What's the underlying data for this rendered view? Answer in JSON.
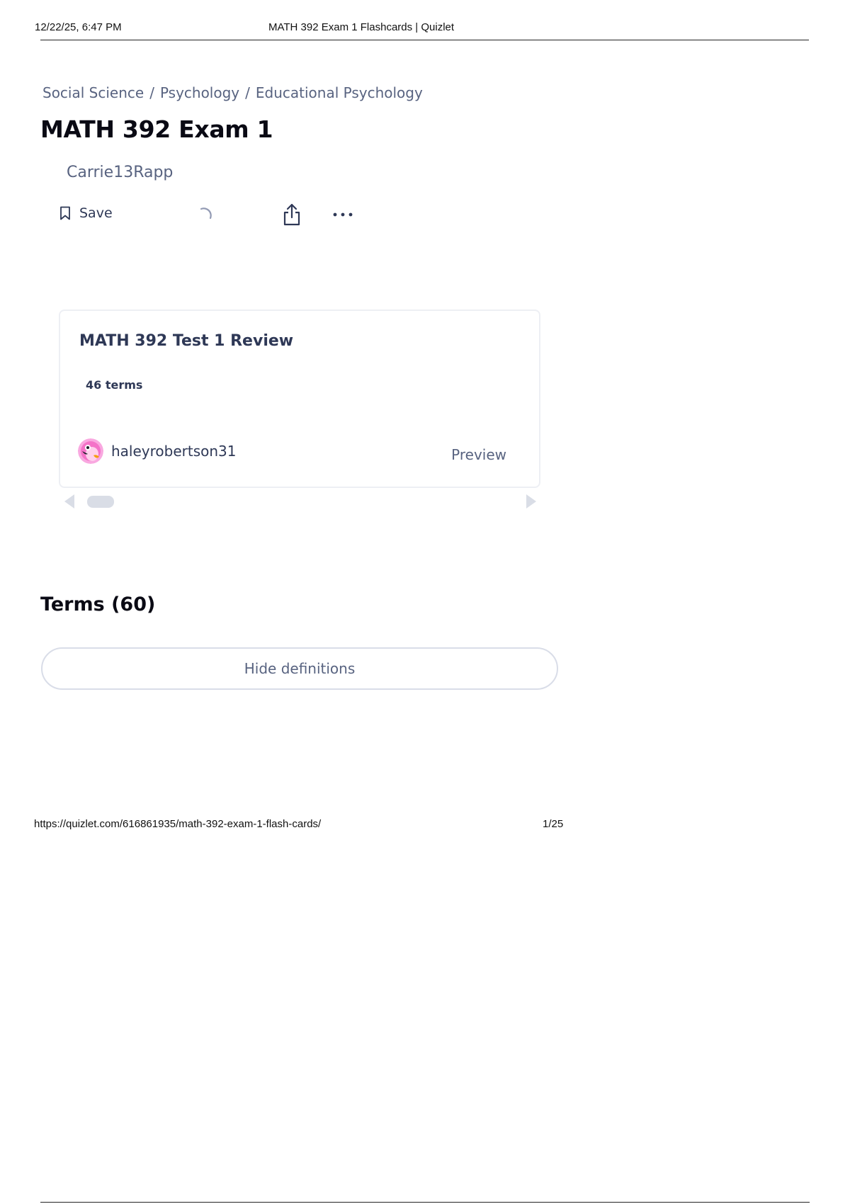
{
  "print_header": {
    "datetime": "12/22/25, 6:47 PM",
    "document_title": "MATH 392 Exam 1 Flashcards | Quizlet"
  },
  "breadcrumb": {
    "items": [
      {
        "label": "Social Science"
      },
      {
        "label": "Psychology"
      },
      {
        "label": "Educational Psychology"
      }
    ],
    "separator": "/"
  },
  "set": {
    "title": "MATH 392 Exam 1",
    "creator": "Carrie13Rapp"
  },
  "actions": {
    "save_label": "Save",
    "save_icon": "bookmark-icon",
    "loading_icon": "spinner-icon",
    "share_icon": "share-icon",
    "more_icon": "more-horizontal-icon"
  },
  "related_card": {
    "title": "MATH 392 Test 1 Review",
    "term_count": "46 terms",
    "author": "haleyrobertson31",
    "preview_label": "Preview",
    "avatar_icon": "flamingo-avatar"
  },
  "terms": {
    "heading": "Terms (60)",
    "toggle_label": "Hide definitions"
  },
  "print_footer": {
    "url": "https://quizlet.com/616861935/math-392-exam-1-flash-cards/",
    "page": "1/25"
  },
  "colors": {
    "text_primary": "#0a0a14",
    "text_secondary": "#586380",
    "text_card": "#2e3856",
    "border": "#edeff4"
  }
}
